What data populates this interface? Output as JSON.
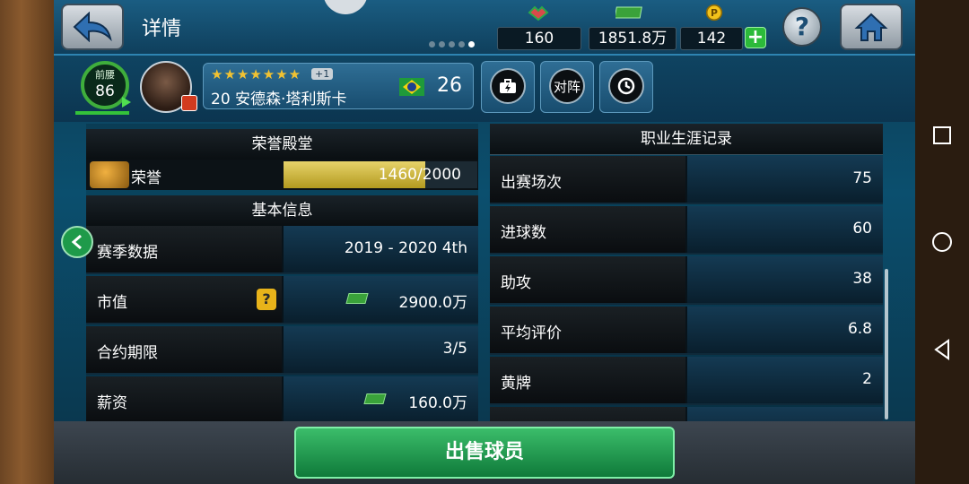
{
  "header": {
    "title": "详情",
    "currencies": [
      {
        "icon": "handshake-icon",
        "value": "160"
      },
      {
        "icon": "cash-icon",
        "value": "1851.8万"
      },
      {
        "icon": "coin-icon",
        "value": "142"
      }
    ],
    "help_label": "?"
  },
  "player": {
    "position_label": "前腰",
    "rating": "86",
    "stars": "★★★★★★★",
    "star_bonus": "+1",
    "name": "20 安德森·塔利斯卡",
    "age": "26",
    "actions": [
      {
        "icon": "transfer-icon",
        "label": ""
      },
      {
        "icon": "vs-icon",
        "label": "对阵"
      },
      {
        "icon": "history-icon",
        "label": ""
      }
    ]
  },
  "hall_of_fame": {
    "title": "荣誉殿堂",
    "label": "荣誉",
    "progress_text": "1460/2000",
    "progress": 0.73
  },
  "basic_info": {
    "title": "基本信息",
    "rows": [
      {
        "label": "赛季数据",
        "value": "2019 - 2020 4th"
      },
      {
        "label": "市值",
        "value": "2900.0万"
      },
      {
        "label": "合约期限",
        "value": "3/5"
      },
      {
        "label": "薪资",
        "value": "160.0万"
      }
    ]
  },
  "career": {
    "title": "职业生涯记录",
    "rows": [
      {
        "label": "出赛场次",
        "value": "75"
      },
      {
        "label": "进球数",
        "value": "60"
      },
      {
        "label": "助攻",
        "value": "38"
      },
      {
        "label": "平均评价",
        "value": "6.8"
      },
      {
        "label": "黄牌",
        "value": "2"
      }
    ]
  },
  "footer": {
    "sell_label": "出售球员"
  }
}
